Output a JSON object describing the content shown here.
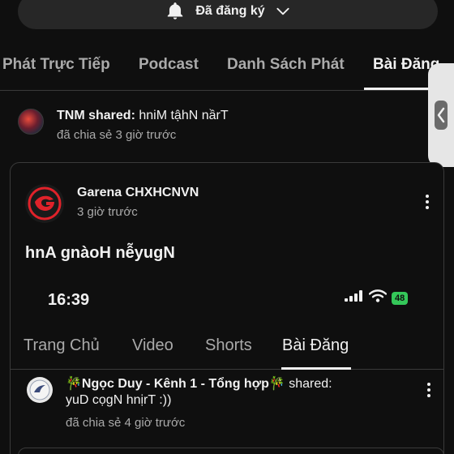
{
  "subscribe": {
    "label": "Đã đăng ký",
    "bell_icon": "bell-icon",
    "chevron_icon": "chevron-down-icon"
  },
  "channel_tabs": [
    {
      "label": "Phát Trực Tiếp"
    },
    {
      "label": "Podcast"
    },
    {
      "label": "Danh Sách Phát"
    },
    {
      "label": "Bài Đăng",
      "active": true
    }
  ],
  "shared_post": {
    "who": "TNM shared:",
    "title": "hniM tậhN nầrT",
    "time": "đã chia sẻ 3 giờ trước"
  },
  "card": {
    "channel": "Garena CHXHCNVN",
    "time": "3 giờ trước",
    "title": "hnA gnàoH nễyugN",
    "screenshot": {
      "status_time": "16:39",
      "battery": "48",
      "tabs": [
        {
          "label": "Trang Chủ"
        },
        {
          "label": "Video"
        },
        {
          "label": "Shorts"
        },
        {
          "label": "Bài Đăng",
          "active": true
        }
      ],
      "nested_post": {
        "who": "🎋Ngọc Duy - Kênh 1 - Tổng hợp🎋",
        "shared": "shared:",
        "title": "yuD cọgN hnịrT :))",
        "time": "đã chia sẻ 4 giờ trước"
      }
    }
  },
  "colors": {
    "background": "#0f0f0f",
    "surface": "#272727",
    "muted_text": "#aaaaaa",
    "battery": "#34c759",
    "garena_red": "#e0222a"
  }
}
